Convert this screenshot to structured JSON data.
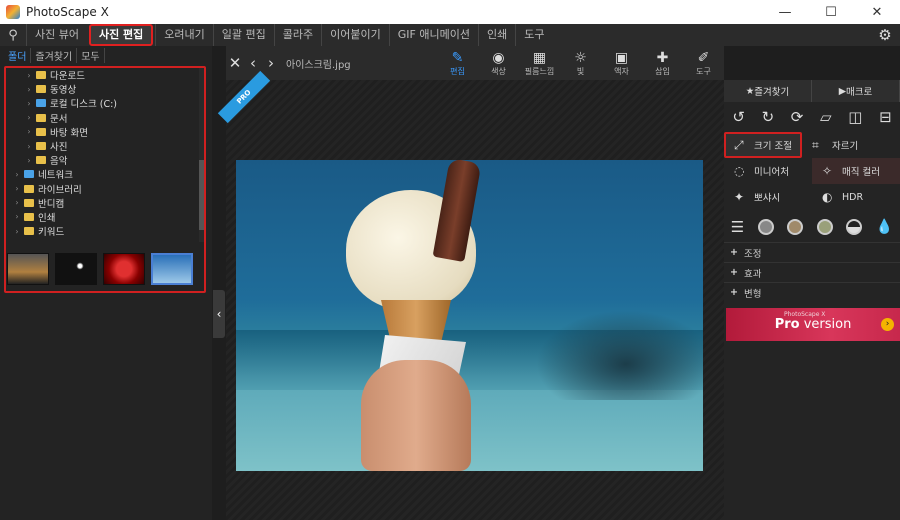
{
  "window": {
    "title": "PhotoScape X",
    "minimize": "—",
    "maximize": "☐",
    "close": "✕"
  },
  "menu": {
    "items": [
      "사진 뷰어",
      "사진 편집",
      "오려내기",
      "일괄 편집",
      "콜라주",
      "이어붙이기",
      "GIF 애니메이션",
      "인쇄",
      "도구"
    ],
    "active_index": 1
  },
  "left": {
    "tabs": [
      "폴더",
      "즐겨찾기",
      "모두"
    ],
    "tree": [
      {
        "label": "다운로드",
        "indent": 1
      },
      {
        "label": "동영상",
        "indent": 1
      },
      {
        "label": "로컬 디스크 (C:)",
        "indent": 1,
        "drive": true
      },
      {
        "label": "문서",
        "indent": 1
      },
      {
        "label": "바탕 화면",
        "indent": 1
      },
      {
        "label": "사진",
        "indent": 1
      },
      {
        "label": "음악",
        "indent": 1
      },
      {
        "label": "네트워크",
        "indent": 0,
        "net": true
      },
      {
        "label": "라이브러리",
        "indent": 0
      },
      {
        "label": "반디캠",
        "indent": 0
      },
      {
        "label": "인쇄",
        "indent": 0
      },
      {
        "label": "키워드",
        "indent": 0
      }
    ],
    "thumbnails": [
      "sunset",
      "moon",
      "flower",
      "icecream"
    ],
    "selected_thumbnail": 3
  },
  "editor": {
    "filename": "아이스크림.jpg",
    "tools": [
      {
        "label": "편집",
        "icon": "edit-icon",
        "glyph": "✎",
        "active": true
      },
      {
        "label": "색상",
        "icon": "color-icon",
        "glyph": "◉"
      },
      {
        "label": "필름느낌",
        "icon": "film-icon",
        "glyph": "▦"
      },
      {
        "label": "빛",
        "icon": "light-icon",
        "glyph": "☼"
      },
      {
        "label": "액자",
        "icon": "frame-icon",
        "glyph": "▣"
      },
      {
        "label": "삽입",
        "icon": "insert-icon",
        "glyph": "✚"
      },
      {
        "label": "도구",
        "icon": "tools-icon",
        "glyph": "✐"
      }
    ],
    "pro_badge": "PRO"
  },
  "right": {
    "tabs": [
      {
        "icon": "★",
        "label": "즐겨찾기"
      },
      {
        "icon": "▶",
        "label": "매크로"
      }
    ],
    "functions": [
      {
        "label": "크기 조절",
        "icon": "⤢",
        "highlight": true
      },
      {
        "label": "자르기",
        "icon": "⌗"
      },
      {
        "label": "미니어처",
        "icon": "◌"
      },
      {
        "label": "매직 컬러",
        "icon": "✧"
      },
      {
        "label": "뽀샤시",
        "icon": "✦"
      },
      {
        "label": "HDR",
        "icon": "◐"
      }
    ],
    "accordions": [
      "조정",
      "효과",
      "변형"
    ],
    "promo": {
      "small": "PhotoScape X",
      "pro": "Pro",
      "version": " version",
      "arrow": "›"
    }
  }
}
